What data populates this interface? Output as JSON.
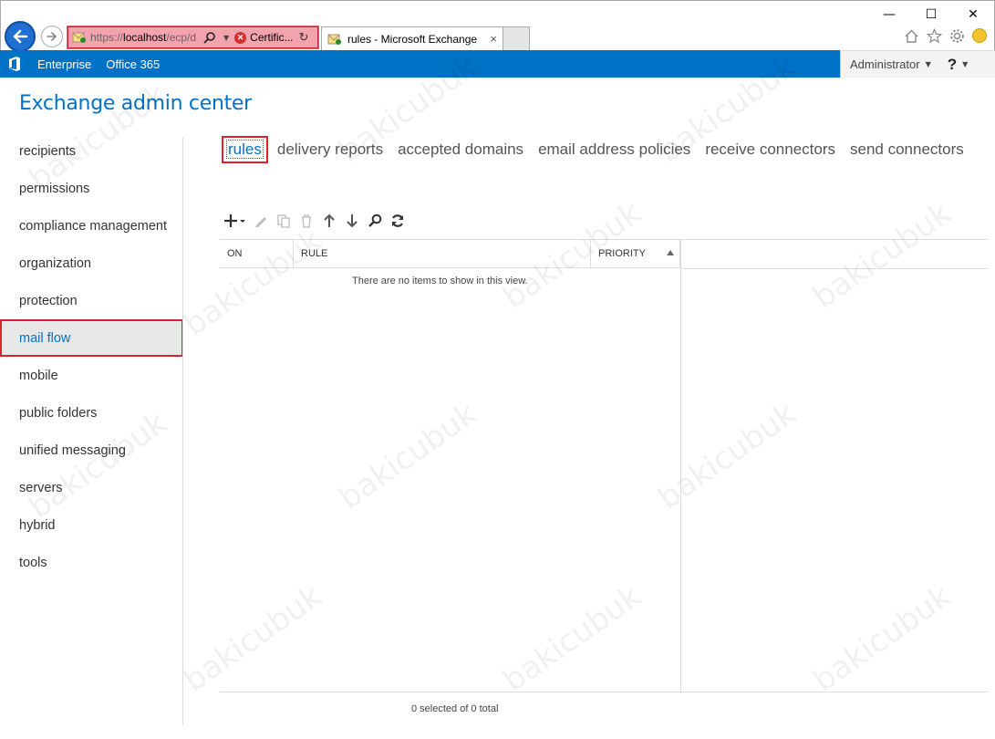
{
  "browser": {
    "back_icon": "back-arrow-icon",
    "forward_icon": "forward-arrow-icon",
    "address": {
      "url_prefix": "https://",
      "url_host": "localhost",
      "url_path": "/ecp/d",
      "cert_text": "Certific..."
    },
    "tab_title": "rules - Microsoft Exchange",
    "tab_close": "×",
    "window": {
      "minimize": "—",
      "maximize": "☐",
      "close": "✕"
    }
  },
  "navbar": {
    "links": [
      "Enterprise",
      "Office 365"
    ],
    "user": "Administrator",
    "help": "?"
  },
  "app": {
    "title": "Exchange admin center"
  },
  "sidebar": {
    "items": [
      {
        "label": "recipients"
      },
      {
        "label": "permissions"
      },
      {
        "label": "compliance management"
      },
      {
        "label": "organization"
      },
      {
        "label": "protection"
      },
      {
        "label": "mail flow",
        "active": true
      },
      {
        "label": "mobile"
      },
      {
        "label": "public folders"
      },
      {
        "label": "unified messaging"
      },
      {
        "label": "servers"
      },
      {
        "label": "hybrid"
      },
      {
        "label": "tools"
      }
    ]
  },
  "tabs": [
    {
      "label": "rules",
      "active": true
    },
    {
      "label": "delivery reports"
    },
    {
      "label": "accepted domains"
    },
    {
      "label": "email address policies"
    },
    {
      "label": "receive connectors"
    },
    {
      "label": "send connectors"
    }
  ],
  "toolbar": {
    "buttons": [
      {
        "name": "add-icon",
        "enabled": true
      },
      {
        "name": "edit-icon",
        "enabled": false
      },
      {
        "name": "copy-icon",
        "enabled": false
      },
      {
        "name": "delete-icon",
        "enabled": false
      },
      {
        "name": "move-up-icon",
        "enabled": true
      },
      {
        "name": "move-down-icon",
        "enabled": true
      },
      {
        "name": "search-icon",
        "enabled": true
      },
      {
        "name": "refresh-icon",
        "enabled": true
      }
    ]
  },
  "grid": {
    "columns": [
      "ON",
      "RULE",
      "PRIORITY"
    ],
    "empty_message": "There are no items to show in this view.",
    "status": "0 selected of 0 total"
  },
  "watermark": "bakicubuk",
  "colors": {
    "brand": "#0072c6",
    "highlight": "#d9232e"
  }
}
